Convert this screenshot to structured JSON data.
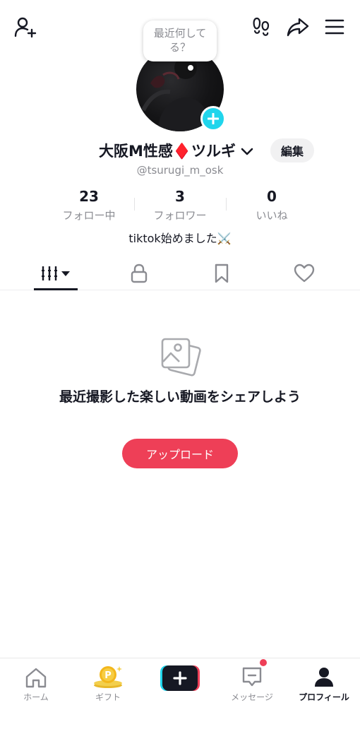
{
  "header": {
    "add_friend_icon": "add-user-icon",
    "footprints_icon": "footprints-icon",
    "share_icon": "share-icon",
    "menu_icon": "menu-icon"
  },
  "bubble": {
    "text": "最近何してる？"
  },
  "profile": {
    "name": "大阪M性感♦️ツルギ",
    "edit_label": "編集",
    "handle": "@tsurugi_m_osk",
    "bio": "tiktok始めました⚔️",
    "stats": [
      {
        "value": "23",
        "label": "フォロー中"
      },
      {
        "value": "3",
        "label": "フォロワー"
      },
      {
        "value": "0",
        "label": "いいね"
      }
    ]
  },
  "tabs": [
    {
      "name": "videos",
      "icon": "grid-icon",
      "active": true
    },
    {
      "name": "private",
      "icon": "lock-icon"
    },
    {
      "name": "saved",
      "icon": "bookmark-icon"
    },
    {
      "name": "liked",
      "icon": "heart-icon"
    }
  ],
  "empty_state": {
    "icon": "photo-icon",
    "title": "最近撮影した楽しい動画をシェアしよう",
    "button_label": "アップロード"
  },
  "bottom_nav": [
    {
      "label": "ホーム",
      "icon": "home-icon"
    },
    {
      "label": "ギフト",
      "icon": "coin-icon"
    },
    {
      "label": "",
      "icon": "create-icon"
    },
    {
      "label": "メッセージ",
      "icon": "inbox-icon"
    },
    {
      "label": "プロフィール",
      "icon": "profile-icon",
      "active": true
    }
  ],
  "colors": {
    "accent": "#ee3f57",
    "cyan": "#20d5ec",
    "text": "#161823",
    "muted": "#8a8b91"
  }
}
